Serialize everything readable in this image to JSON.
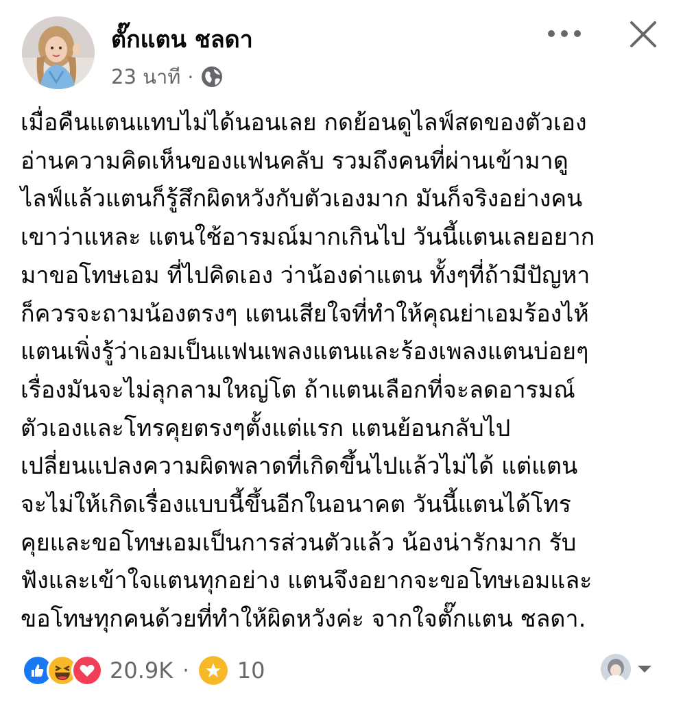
{
  "post": {
    "author": "ตั๊กแตน ชลดา",
    "time": "23 นาที",
    "separator": "·",
    "audience_icon": "globe-icon",
    "lines": [
      "เมื่อคืนแตนแทบไม่ได้นอนเลย กดย้อนดูไลฟ์สดของตัวเอง",
      "อ่านความคิดเห็นของแฟนคลับ รวมถึงคนที่ผ่านเข้ามาดู",
      "ไลฟ์แล้วแตนก็รู้สึกผิดหวังกับตัวเองมาก มันก็จริงอย่างคน",
      "เขาว่าแหละ แตนใช้อารมณ์มากเกินไป วันนี้แตนเลยอยาก",
      "มาขอโทษเอม ที่ไปคิดเอง ว่าน้องด่าแตน ทั้งๆที่ถ้ามีปัญหา",
      "ก็ควรจะถามน้องตรงๆ แตนเสียใจที่ทำให้คุณย่าเอมร้องไห้",
      "แตนเพิ่งรู้ว่าเอมเป็นแฟนเพลงแตนและร้องเพลงแตนบ่อยๆ",
      "เรื่องมันจะไม่ลุกลามใหญ่โต ถ้าแตนเลือกที่จะลดอารมณ์",
      "ตัวเองและโทรคุยตรงๆตั้งแต่แรก แตนย้อนกลับไป",
      "เปลี่ยนแปลงความผิดพลาดที่เกิดขึ้นไปแล้วไม่ได้ แต่แตน",
      "จะไม่ให้เกิดเรื่องแบบนี้ขึ้นอีกในอนาคต วันนี้แตนได้โทร",
      "คุยและขอโทษเอมเป็นการส่วนตัวแล้ว น้องน่ารักมาก รับ",
      "ฟังและเข้าใจแตนทุกอย่าง แตนจึงอยากจะขอโทษเอมและ",
      "ขอโทษทุกคนด้วยที่ทำให้ผิดหวังค่ะ จากใจตั๊กแตน ชลดา."
    ]
  },
  "footer": {
    "reactions": [
      "like-icon",
      "haha-icon",
      "love-icon"
    ],
    "reaction_count": "20.9K",
    "separator": "·",
    "stars_icon": "star-icon",
    "stars_count": "10"
  },
  "colors": {
    "text": "#050505",
    "secondary": "#65676b",
    "like_blue": "#1877f2",
    "love_red": "#f33e58",
    "haha_yellow": "#f7b928"
  }
}
